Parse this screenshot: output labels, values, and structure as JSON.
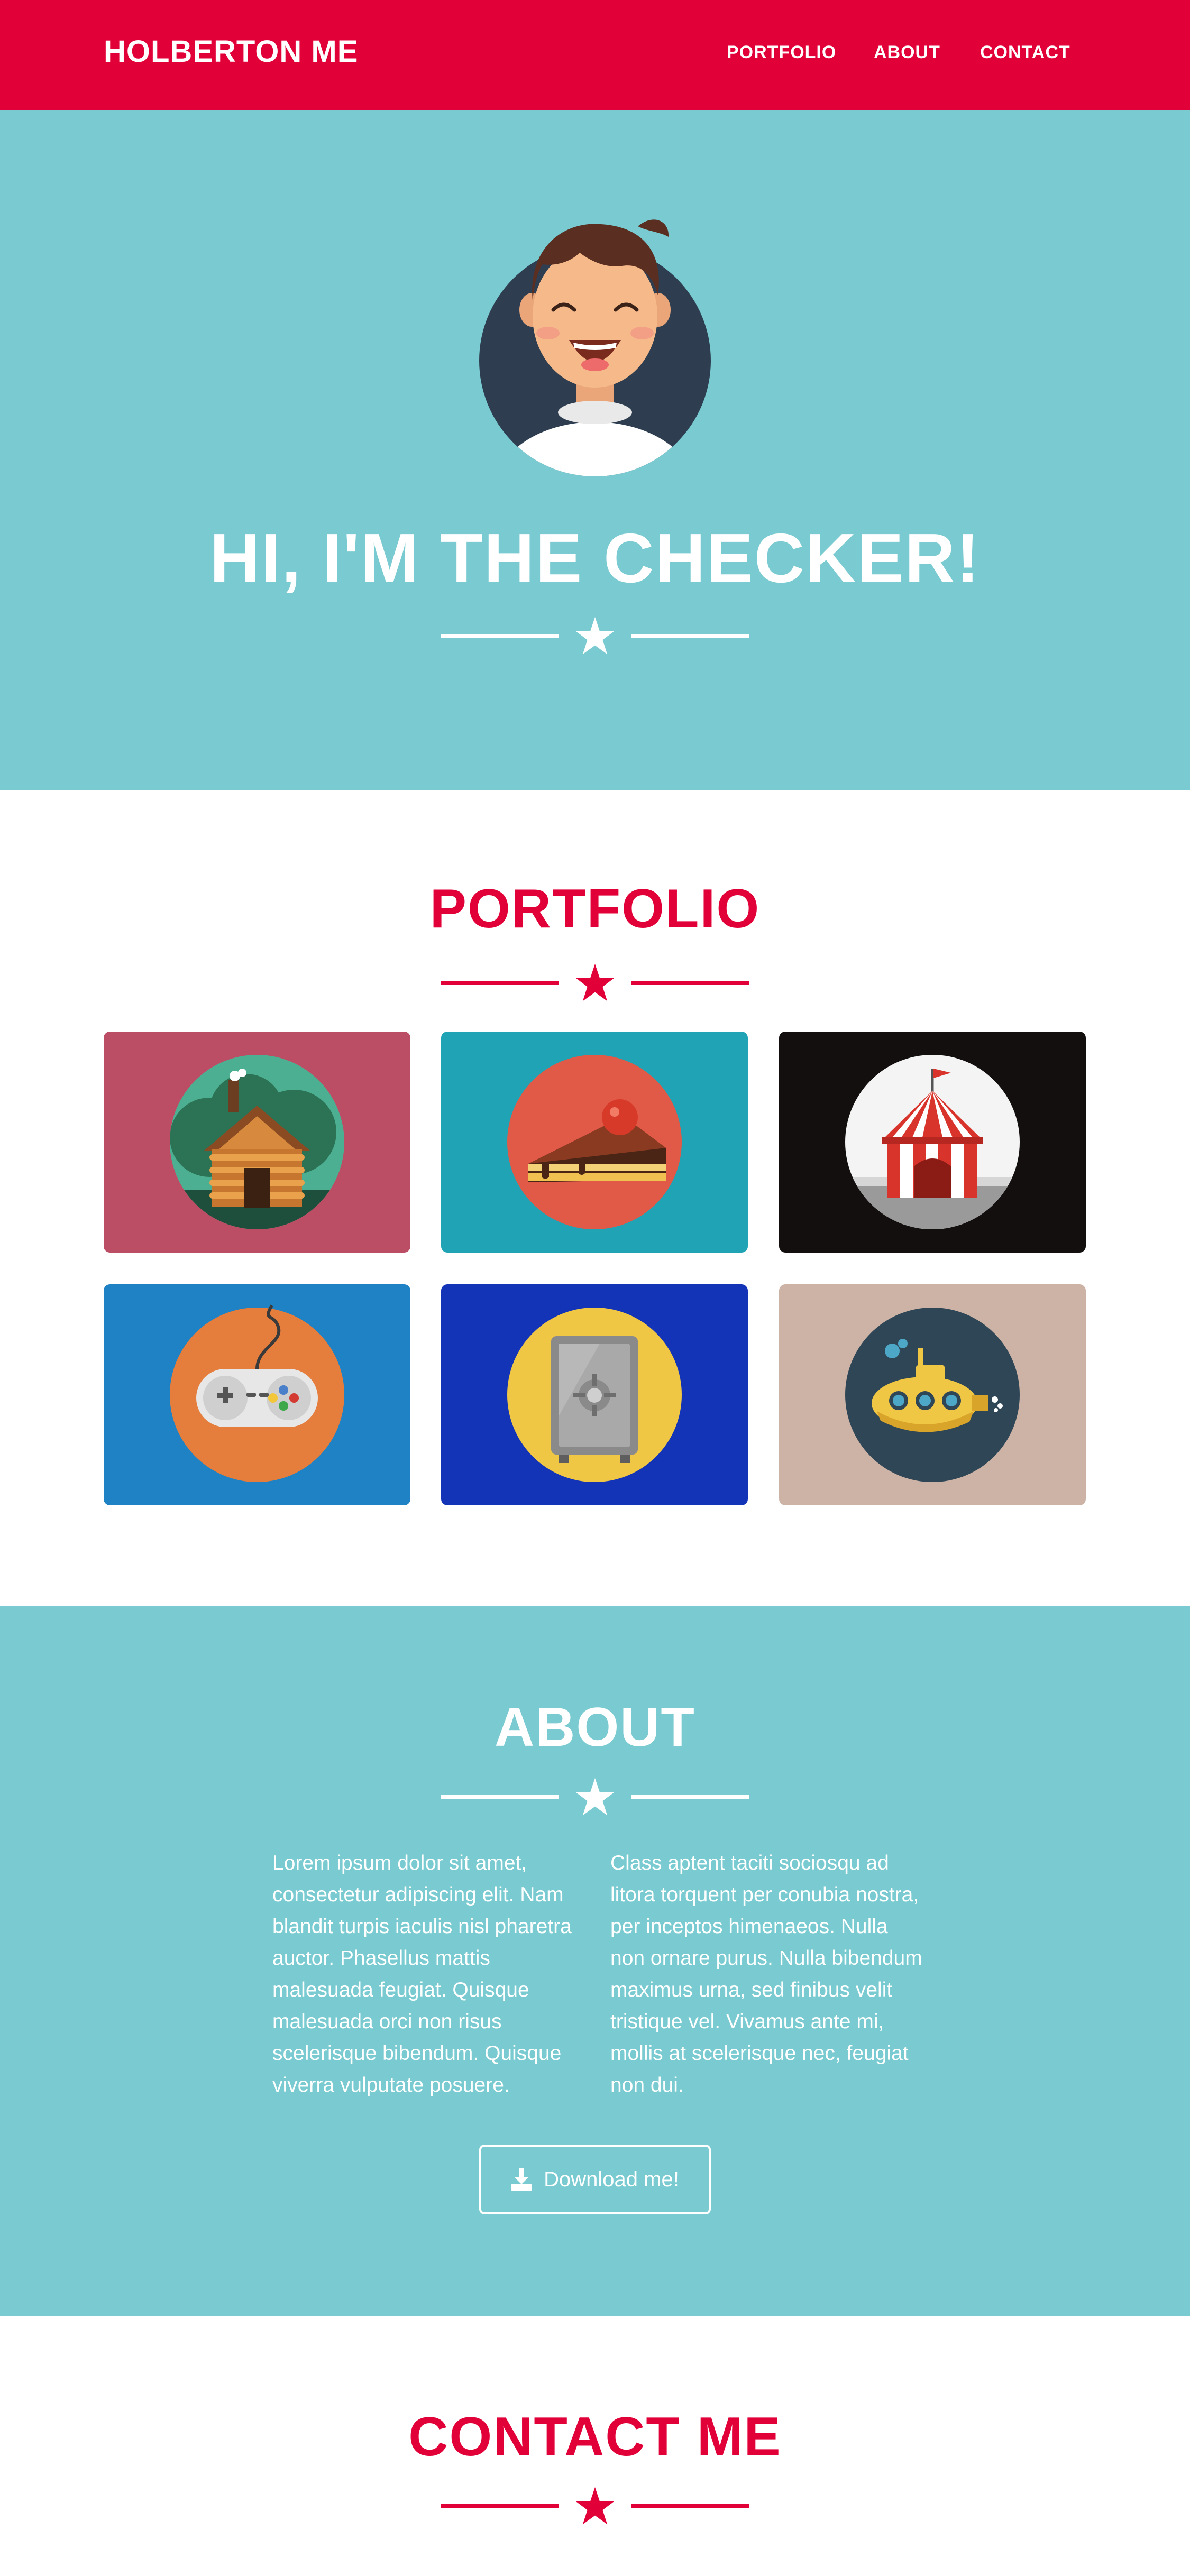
{
  "nav": {
    "brand": "HOLBERTON ME",
    "links": [
      "PORTFOLIO",
      "ABOUT",
      "CONTACT"
    ]
  },
  "hero": {
    "title": "HI, I'M THE CHECKER!",
    "avatar_icon": "avatar-icon",
    "divider_icon": "star-icon"
  },
  "portfolio": {
    "title": "PORTFOLIO",
    "tiles": [
      {
        "icon": "cabin-icon",
        "bg": "#bb4e65"
      },
      {
        "icon": "cake-icon",
        "bg": "#1fa3b5"
      },
      {
        "icon": "circus-tent-icon",
        "bg": "#140f0f"
      },
      {
        "icon": "game-controller-icon",
        "bg": "#1e82c4"
      },
      {
        "icon": "safe-icon",
        "bg": "#1434b8"
      },
      {
        "icon": "submarine-icon",
        "bg": "#cdb3a6"
      }
    ]
  },
  "about": {
    "title": "ABOUT",
    "col1": "Lorem ipsum dolor sit amet, consectetur adipiscing elit. Nam blandit turpis iaculis nisl pharetra auctor. Phasellus mattis malesuada feugiat. Quisque malesuada orci non risus scelerisque bibendum. Quisque viverra vulputate posuere.",
    "col2": "Class aptent taciti sociosqu ad litora torquent per conubia nostra, per inceptos himenaeos. Nulla non ornare purus. Nulla bibendum maximus urna, sed finibus velit tristique vel. Vivamus ante mi, mollis at scelerisque nec, feugiat non dui.",
    "button_label": "Download me!",
    "button_icon": "download-icon"
  },
  "contact": {
    "title": "CONTACT ME"
  },
  "colors": {
    "brand_red": "#e20038",
    "teal": "#79cbd1",
    "white": "#ffffff"
  }
}
